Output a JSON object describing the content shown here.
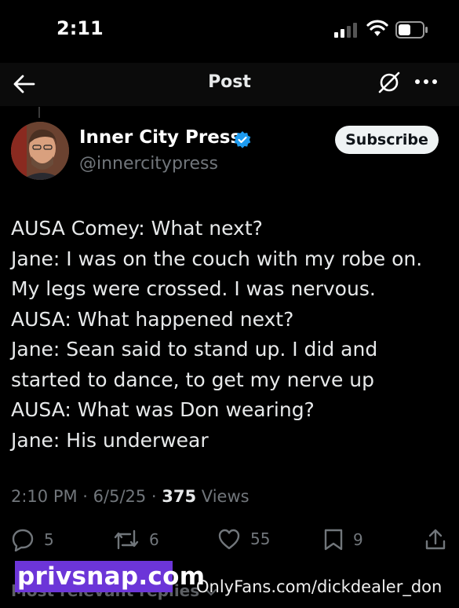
{
  "status_bar": {
    "time": "2:11"
  },
  "nav": {
    "title": "Post"
  },
  "post": {
    "author_name": "Inner City Press",
    "handle": "@innercitypress",
    "subscribe_label": "Subscribe",
    "lines": [
      "AUSA Comey: What next?",
      "Jane: I was on the couch with my robe on.",
      "My legs were crossed. I was nervous.",
      "AUSA: What happened next?",
      "Jane: Sean said to stand up. I did and",
      "started to dance, to get my nerve up",
      "AUSA: What was Don wearing?",
      "Jane: His underwear"
    ],
    "timestamp": "2:10 PM · 6/5/25 · ",
    "views_count": "375",
    "views_label": " Views"
  },
  "actions": {
    "replies": "5",
    "reposts": "6",
    "likes": "55",
    "bookmarks": "9"
  },
  "replies_sort": "Most relevant replies",
  "watermark": {
    "site": "privsnap.com",
    "onlyfans": "OnlyFans.com/dickdealer_don"
  },
  "colors": {
    "background": "#000000",
    "verified": "#1d9bf0",
    "muted": "#71767b",
    "watermark_bg": "#6c35d8"
  }
}
